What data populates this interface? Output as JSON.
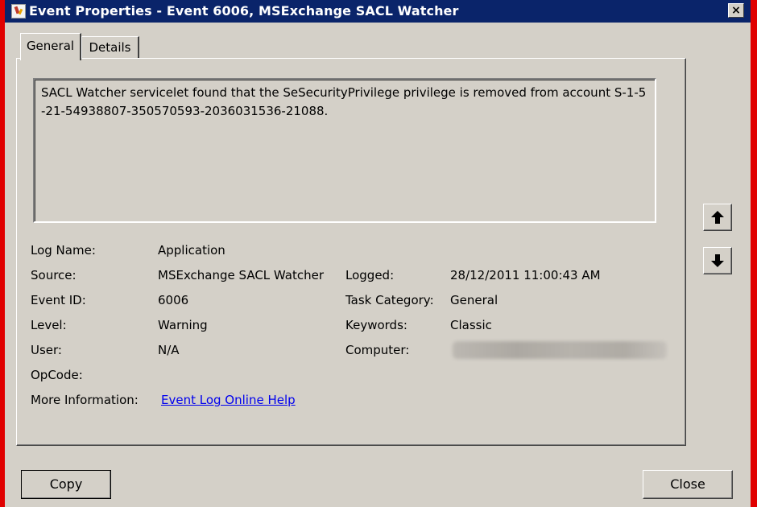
{
  "window": {
    "title": "Event Properties - Event 6006, MSExchange SACL Watcher",
    "close_glyph": "×"
  },
  "tabs": [
    {
      "label": "General",
      "selected": true
    },
    {
      "label": "Details",
      "selected": false
    }
  ],
  "description": "SACL Watcher servicelet found that the SeSecurityPrivilege privilege is removed from account S-1-5-21-54938807-350570593-2036031536-21088.",
  "fields": {
    "log_name_label": "Log Name:",
    "log_name_value": "Application",
    "source_label": "Source:",
    "source_value": "MSExchange SACL Watcher",
    "logged_label": "Logged:",
    "logged_value": "28/12/2011 11:00:43 AM",
    "event_id_label": "Event ID:",
    "event_id_value": "6006",
    "task_category_label": "Task Category:",
    "task_category_value": "General",
    "level_label": "Level:",
    "level_value": "Warning",
    "keywords_label": "Keywords:",
    "keywords_value": "Classic",
    "user_label": "User:",
    "user_value": "N/A",
    "computer_label": "Computer:",
    "computer_value_redacted": true,
    "opcode_label": "OpCode:",
    "more_info_label": "More Information:",
    "more_info_link": "Event Log Online Help"
  },
  "buttons": {
    "copy": "Copy",
    "close": "Close",
    "up_icon": "arrow-up-icon",
    "down_icon": "arrow-down-icon"
  },
  "colors": {
    "title_bar": "#0a246a",
    "face": "#d4d0c8",
    "link": "#0000ee",
    "frame": "#e00000"
  }
}
